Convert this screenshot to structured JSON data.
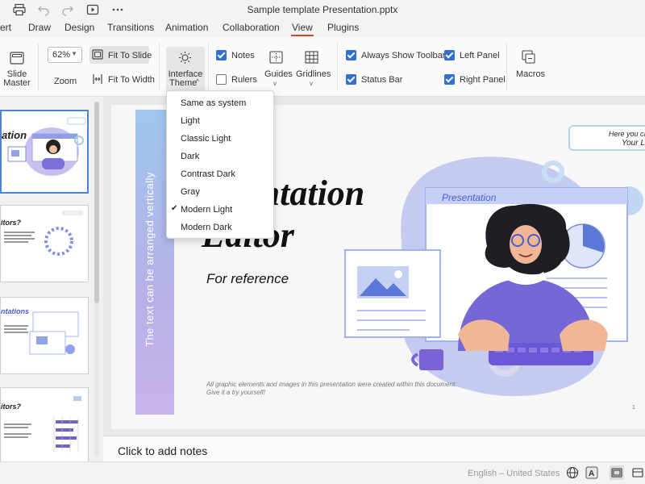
{
  "window": {
    "title": "Sample template Presentation.pptx"
  },
  "titlebar_icons": [
    "print-icon",
    "undo-icon",
    "redo-icon",
    "slideshow-icon",
    "more-icon"
  ],
  "menu": {
    "tabs": [
      "ert",
      "Draw",
      "Design",
      "Transitions",
      "Animation",
      "Collaboration",
      "View",
      "Plugins"
    ],
    "active": "View"
  },
  "ribbon": {
    "slide_master": [
      "Slide",
      "Master"
    ],
    "zoom_value": "62%",
    "zoom_label": "Zoom",
    "fit_to_slide": "Fit To Slide",
    "fit_to_width": "Fit To Width",
    "interface_theme": [
      "Interface",
      "Theme"
    ],
    "notes": {
      "label": "Notes",
      "checked": true
    },
    "rulers": {
      "label": "Rulers",
      "checked": false
    },
    "guides": "Guides",
    "gridlines": "Gridlines",
    "always_show_toolbar": {
      "label": "Always Show Toolbar",
      "checked": true
    },
    "status_bar": {
      "label": "Status Bar",
      "checked": true
    },
    "left_panel": {
      "label": "Left Panel",
      "checked": true
    },
    "right_panel": {
      "label": "Right Panel",
      "checked": true
    },
    "macros": "Macros"
  },
  "theme_menu": {
    "items": [
      "Same as system",
      "Light",
      "Classic Light",
      "Dark",
      "Contrast Dark",
      "Gray",
      "Modern Light",
      "Modern Dark"
    ],
    "selected": "Modern Light"
  },
  "thumbnails": [
    {
      "title": "ation",
      "selected": true
    },
    {
      "title": "itors?",
      "selected": false
    },
    {
      "title": "ntations",
      "selected": false
    },
    {
      "title": "itors?",
      "selected": false
    }
  ],
  "slide": {
    "vertical_text": "The text can be arranged vertically",
    "title_line1": "sentation",
    "title_line2": "Editor",
    "subtitle": "For reference",
    "footnote_line1": "All graphic elements and images in this presentation were created within this document.",
    "footnote_line2": "Give it a try yourself!",
    "callout_line1": "Here you can",
    "callout_line2": "Your Lo",
    "laptop_label": "Presentation",
    "page_number": "1"
  },
  "notes": {
    "placeholder": "Click to add notes"
  },
  "statusbar": {
    "language": "English – United States"
  },
  "colors": {
    "accent": "#d9452b",
    "checkbox": "#2f6fd6",
    "selection": "#4a86d8"
  }
}
